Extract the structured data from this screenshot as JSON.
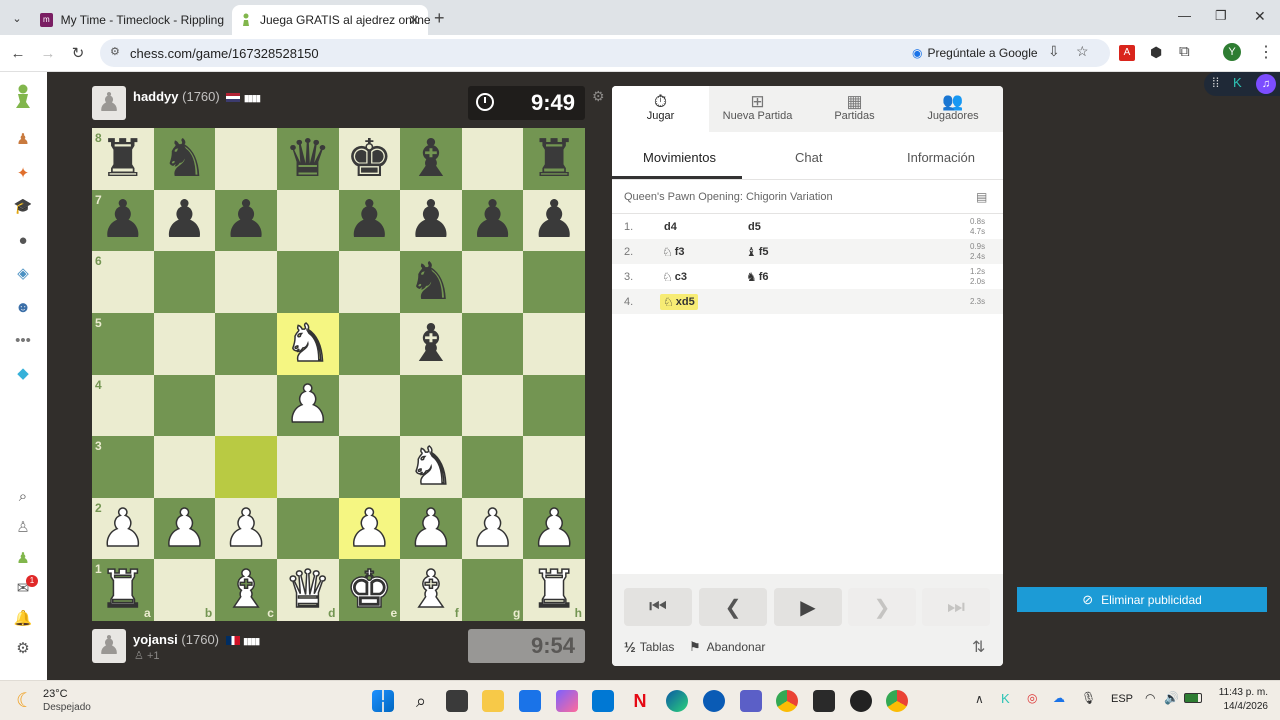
{
  "browser": {
    "tabs": [
      {
        "title": "My Time - Timeclock - Rippling",
        "icon": "rippling-icon"
      },
      {
        "title": "Juega GRATIS al ajedrez online",
        "icon": "chesscom-pawn-icon"
      }
    ],
    "url": "chess.com/game/167328528150",
    "ask_google": "Pregúntale a Google",
    "profile_initial": "Y"
  },
  "left_nav": {
    "icons": [
      "chesscom-logo-icon",
      "play-icon",
      "puzzles-icon",
      "learn-icon",
      "watch-icon",
      "news-icon",
      "social-icon",
      "more-icon",
      "diamond-icon",
      "search-icon",
      "profile-icon",
      "friends-icon",
      "messages-icon",
      "notifications-icon",
      "settings-icon"
    ],
    "messages_badge": "1"
  },
  "top_player": {
    "name": "haddyy",
    "rating": "(1760)",
    "clock": "9:49"
  },
  "bottom_player": {
    "name": "yojansi",
    "rating": "(1760)",
    "extra": "+1",
    "clock": "9:54"
  },
  "board": {
    "ranks": [
      "8",
      "7",
      "6",
      "5",
      "4",
      "3",
      "2",
      "1"
    ],
    "files": [
      "a",
      "b",
      "c",
      "d",
      "e",
      "f",
      "g",
      "h"
    ],
    "position": [
      [
        "br",
        "bn",
        "",
        "bq",
        "bk",
        "bb",
        "",
        "br"
      ],
      [
        "bp",
        "bp",
        "bp",
        "",
        "bp",
        "bp",
        "bp",
        "bp"
      ],
      [
        "",
        "",
        "",
        "",
        "",
        "bn",
        "",
        ""
      ],
      [
        "",
        "",
        "",
        "wn",
        "",
        "bb",
        "",
        ""
      ],
      [
        "",
        "",
        "",
        "wp",
        "",
        "",
        "",
        ""
      ],
      [
        "",
        "",
        "",
        "",
        "",
        "wn",
        "",
        ""
      ],
      [
        "wp",
        "wp",
        "wp",
        "",
        "wp",
        "wp",
        "wp",
        "wp"
      ],
      [
        "wr",
        "",
        "wb",
        "wq",
        "wk",
        "wb",
        "",
        "wr"
      ]
    ],
    "highlights": [
      "c3",
      "e2",
      "d5"
    ]
  },
  "panel": {
    "tabs": [
      {
        "label": "Jugar",
        "icon": "stopwatch-icon"
      },
      {
        "label": "Nueva Partida",
        "icon": "plus-square-icon"
      },
      {
        "label": "Partidas",
        "icon": "board-icon"
      },
      {
        "label": "Jugadores",
        "icon": "players-icon"
      }
    ],
    "subtabs": [
      "Movimientos",
      "Chat",
      "Información"
    ],
    "opening": "Queen's Pawn Opening: Chigorin Variation",
    "moves": [
      {
        "num": "1.",
        "white": "d4",
        "white_piece": "",
        "black": "d5",
        "black_piece": "",
        "times": [
          "0.8s",
          "4.7s"
        ]
      },
      {
        "num": "2.",
        "white": "f3",
        "white_piece": "♘",
        "black": "f5",
        "black_piece": "♝",
        "times": [
          "0.9s",
          "2.4s"
        ]
      },
      {
        "num": "3.",
        "white": "c3",
        "white_piece": "♘",
        "black": "f6",
        "black_piece": "♞",
        "times": [
          "1.2s",
          "2.0s"
        ]
      },
      {
        "num": "4.",
        "white": "xd5",
        "white_piece": "♘",
        "black": "",
        "black_piece": "",
        "times": [
          "2.3s"
        ]
      }
    ],
    "draw_label": "Tablas",
    "draw_symbol": "½",
    "resign_label": "Abandonar"
  },
  "ad": {
    "remove_label": "Eliminar publicidad"
  },
  "taskbar": {
    "weather_temp": "23°C",
    "weather_desc": "Despejado",
    "lang": "ESP",
    "time": "11:43 p. m.",
    "date": "14/4/2026"
  },
  "colors": {
    "board_light": "#ebecd0",
    "board_dark": "#739552",
    "highlight": "#f5f682",
    "accent": "#1c9bd6"
  }
}
